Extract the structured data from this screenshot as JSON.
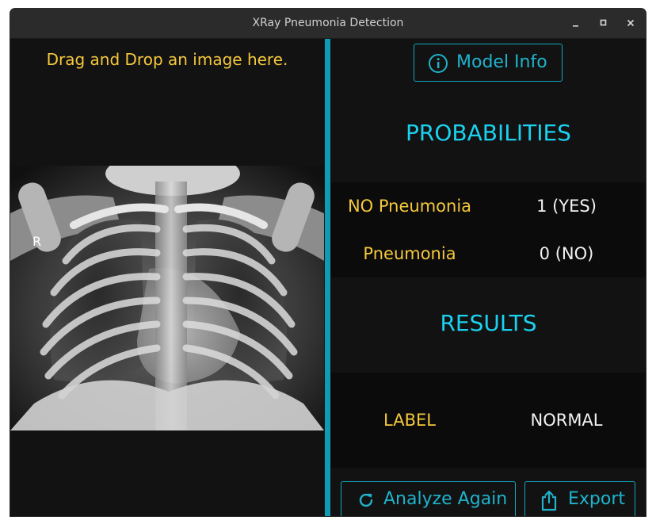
{
  "window": {
    "title": "XRay Pneumonia Detection",
    "controls": {
      "minimize": "–",
      "maximize": "□",
      "close": "×"
    }
  },
  "left": {
    "drop_label": "Drag and Drop an image here.",
    "xray_marker": "R"
  },
  "right": {
    "model_info_label": "Model Info",
    "probabilities_title": "PROBABILITIES",
    "probabilities": [
      {
        "label": "NO Pneumonia",
        "value": "1 (YES)"
      },
      {
        "label": "Pneumonia",
        "value": "0 (NO)"
      }
    ],
    "results_title": "RESULTS",
    "result_label": "LABEL",
    "result_value": "NORMAL",
    "analyze_label": "Analyze Again",
    "export_label": "Export"
  },
  "colors": {
    "accent": "#1fb3cc",
    "title_cyan": "#1ad2f0",
    "label_yellow": "#f5c83c",
    "splitter": "#0e9bb4",
    "background": "#121212"
  },
  "icons": {
    "model_info": "info-icon",
    "analyze": "refresh-icon",
    "export": "share-export-icon"
  }
}
